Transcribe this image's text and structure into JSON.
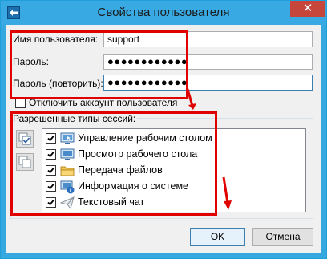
{
  "window": {
    "title": "Свойства пользователя",
    "close_glyph": "✕"
  },
  "form": {
    "username_label": "Имя пользователя:",
    "username_value": "support",
    "password_label": "Пароль:",
    "password_value": "●●●●●●●●●●●●",
    "password_repeat_label": "Пароль (повторить):",
    "password_repeat_value": "●●●●●●●●●●●●",
    "disable_account_label": "Отключить аккаунт пользователя",
    "disable_account_checked": false
  },
  "session_types": {
    "group_title": "Разрешенные типы сессий:",
    "items": [
      {
        "label": "Управление рабочим столом",
        "checked": true,
        "icon": "remote-control-icon"
      },
      {
        "label": "Просмотр рабочего стола",
        "checked": true,
        "icon": "monitor-icon"
      },
      {
        "label": "Передача файлов",
        "checked": true,
        "icon": "folder-icon"
      },
      {
        "label": "Информация о системе",
        "checked": true,
        "icon": "system-info-icon"
      },
      {
        "label": "Текстовый чат",
        "checked": true,
        "icon": "chat-icon"
      }
    ]
  },
  "buttons": {
    "ok": "OK",
    "cancel": "Отмена"
  },
  "colors": {
    "titlebar": "#38a9e2",
    "close": "#c7463c",
    "annotation": "#e00000"
  }
}
